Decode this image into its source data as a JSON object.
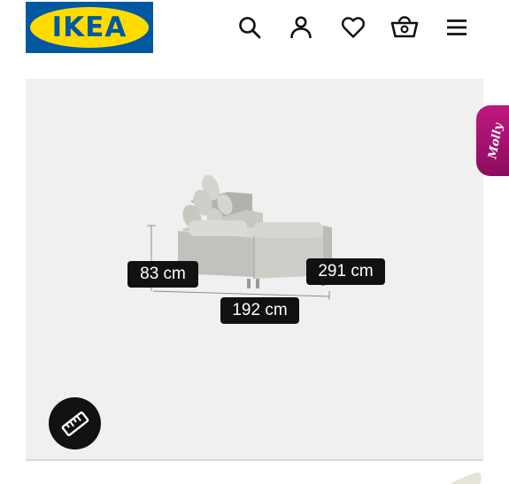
{
  "header": {
    "logo_text": "IKEA",
    "logo_mark": "®",
    "icons": [
      "search-icon",
      "account-icon",
      "heart-icon",
      "basket-icon",
      "menu-icon"
    ]
  },
  "viewer": {
    "dimensions": {
      "height": "83 cm",
      "depth": "291 cm",
      "width": "192 cm"
    },
    "measure_icon": "ruler-icon"
  },
  "chat": {
    "label": "Molly"
  },
  "colors": {
    "brand_blue": "#0058a3",
    "brand_yellow": "#ffdb00",
    "viewer_bg": "#f0f0f0",
    "label_bg": "#111111",
    "molly_magenta": "#b0146f"
  }
}
